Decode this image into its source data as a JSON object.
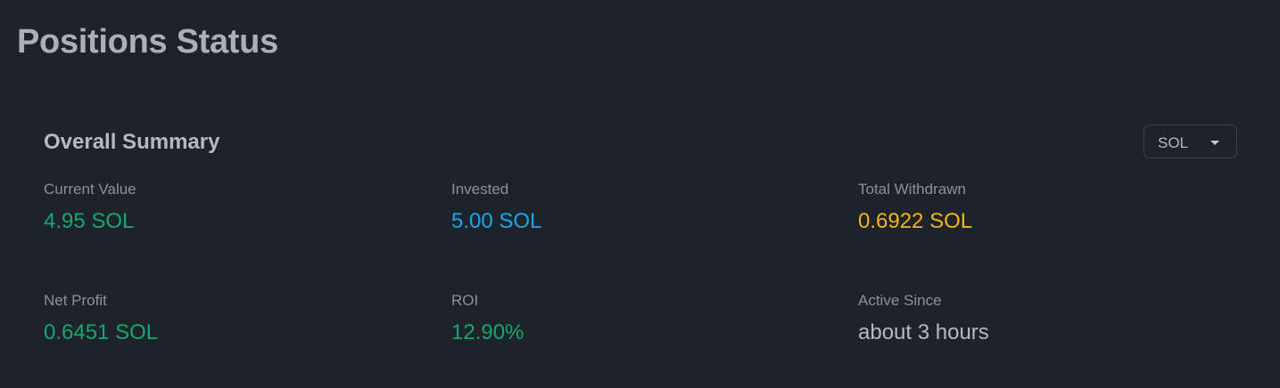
{
  "page": {
    "title": "Positions Status"
  },
  "summary": {
    "title": "Overall Summary",
    "currency_select": {
      "value": "SOL"
    },
    "stats": [
      {
        "label": "Current Value",
        "value": "4.95 SOL",
        "color": "#14a86b"
      },
      {
        "label": "Invested",
        "value": "5.00 SOL",
        "color": "#16a8ec"
      },
      {
        "label": "Total Withdrawn",
        "value": "0.6922 SOL",
        "color": "#f3b612"
      },
      {
        "label": "Net Profit",
        "value": "0.6451 SOL",
        "color": "#14a86b"
      },
      {
        "label": "ROI",
        "value": "12.90%",
        "color": "#14a86b"
      },
      {
        "label": "Active Since",
        "value": "about 3 hours",
        "color": "#b4bac4"
      }
    ]
  },
  "colors": {
    "background": "#1e232b",
    "positive": "#14a86b",
    "info": "#16a8ec",
    "warning": "#f3b612"
  }
}
